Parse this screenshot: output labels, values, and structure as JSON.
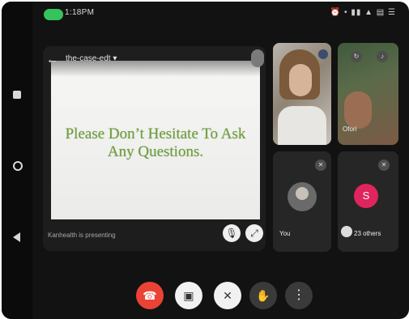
{
  "status_bar": {
    "time": "1:18PM",
    "right_icons": "⏰ • ▮▮ ▲ ▤ ☰"
  },
  "presentation": {
    "title": "the-case-edt ▾",
    "slide_text_line1": "Please Don’t Hesitate To Ask",
    "slide_text_line2": "Any Questions.",
    "footer_label": "Kanhealth is presenting"
  },
  "participants": {
    "tile_2_label": "Ofori",
    "you_label": "You",
    "others_avatar_letter": "S",
    "others_label": "23 others"
  },
  "icons": {
    "back": "←",
    "mic": "🎙",
    "expand": "⤢",
    "end_call": "☎",
    "camera_off": "▣",
    "mic_off": "✕",
    "hand": "✋",
    "more": "⋮",
    "muted_small": "✕"
  },
  "colors": {
    "end_call": "#ea4335",
    "slide_text": "#6d9d3c",
    "avatar_bg": "#e0245e",
    "call_pill": "#35c35c"
  }
}
